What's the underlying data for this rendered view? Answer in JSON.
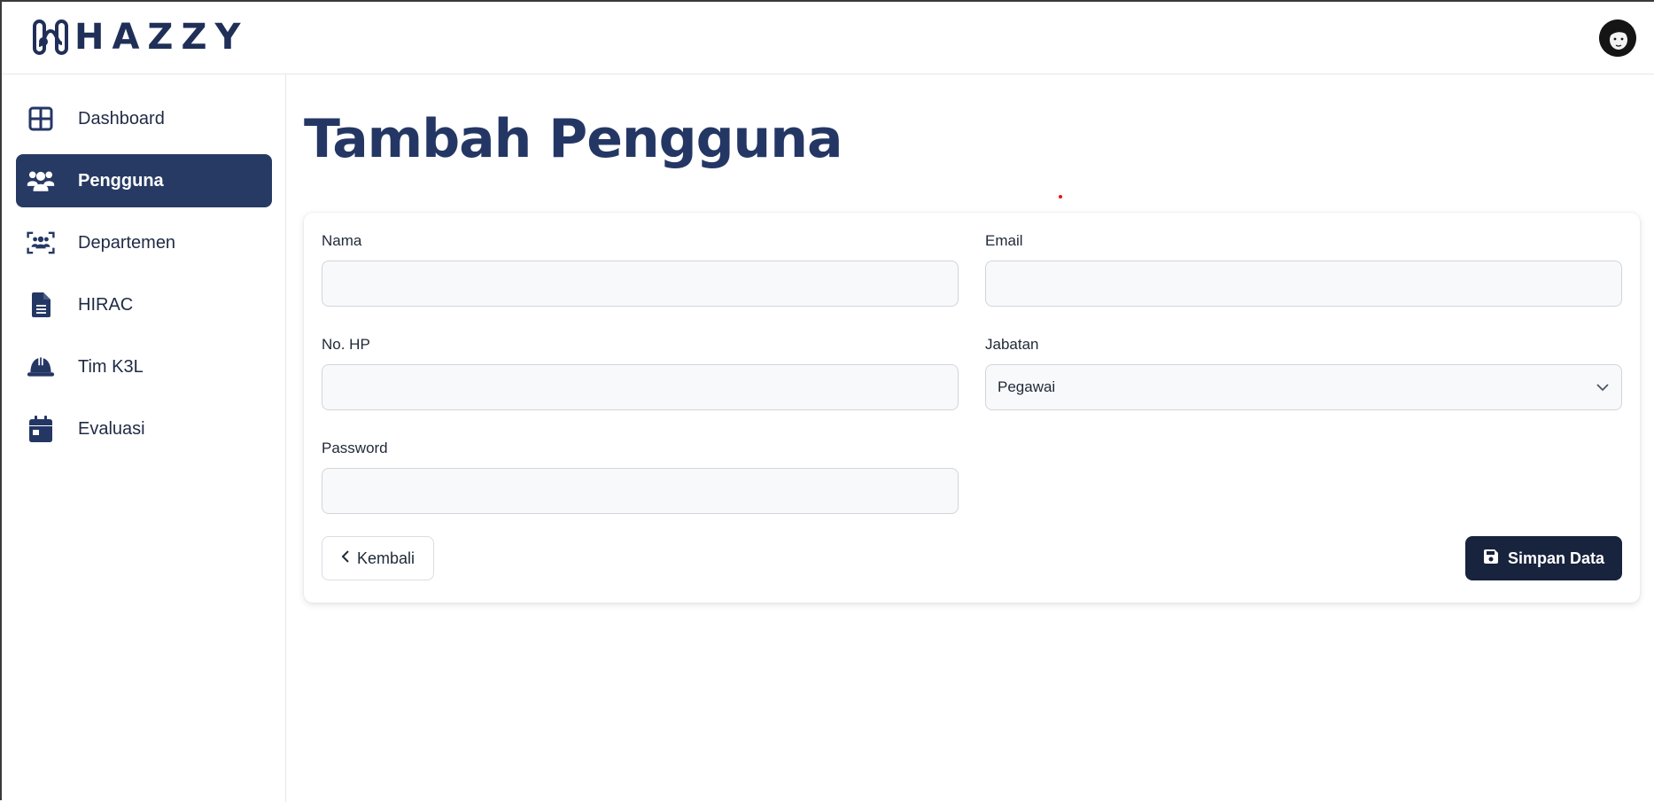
{
  "brand": {
    "name": "HAZZY"
  },
  "header": {
    "avatar_icon": "user-avatar"
  },
  "sidebar": {
    "items": [
      {
        "label": "Dashboard",
        "icon": "dashboard-grid-icon",
        "active": false
      },
      {
        "label": "Pengguna",
        "icon": "users-icon",
        "active": true
      },
      {
        "label": "Departemen",
        "icon": "department-group-icon",
        "active": false
      },
      {
        "label": "HIRAC",
        "icon": "document-icon",
        "active": false
      },
      {
        "label": "Tim K3L",
        "icon": "hard-hat-icon",
        "active": false
      },
      {
        "label": "Evaluasi",
        "icon": "calendar-icon",
        "active": false
      }
    ]
  },
  "page": {
    "title": "Tambah Pengguna"
  },
  "form": {
    "nama": {
      "label": "Nama",
      "value": "",
      "placeholder": ""
    },
    "email": {
      "label": "Email",
      "value": "",
      "placeholder": ""
    },
    "no_hp": {
      "label": "No. HP",
      "value": "",
      "placeholder": ""
    },
    "jabatan": {
      "label": "Jabatan",
      "selected": "Pegawai"
    },
    "password": {
      "label": "Password",
      "value": "",
      "placeholder": ""
    }
  },
  "actions": {
    "back_label": "Kembali",
    "save_label": "Simpan Data"
  },
  "colors": {
    "primary": "#273a63",
    "button_dark": "#18233d",
    "title": "#243764"
  }
}
